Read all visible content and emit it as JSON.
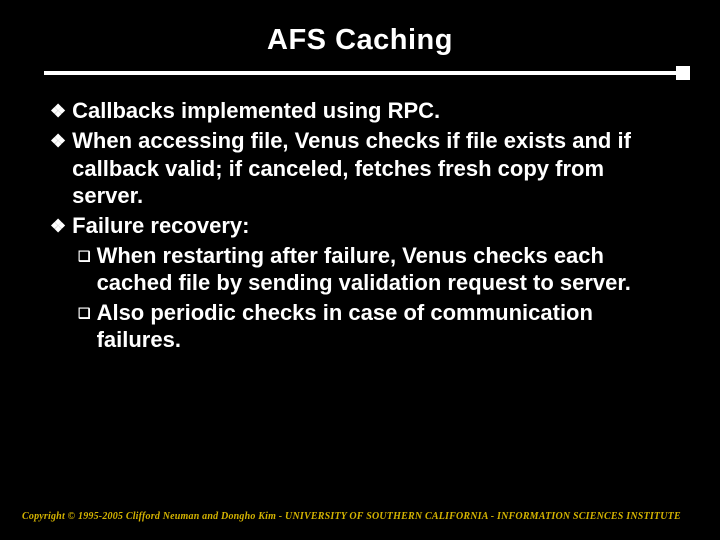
{
  "title": "AFS Caching",
  "bullets": [
    {
      "text": "Callbacks implemented using RPC."
    },
    {
      "text": "When accessing file, Venus checks if file exists and if callback valid; if canceled, fetches fresh copy from server."
    },
    {
      "text": "Failure recovery:",
      "sub": [
        {
          "text": "When restarting after failure, Venus checks each cached file by sending validation request to server."
        },
        {
          "text": "Also periodic checks in case of communication failures."
        }
      ]
    }
  ],
  "footer": "Copyright © 1995-2005 Clifford Neuman and Dongho Kim - UNIVERSITY OF SOUTHERN CALIFORNIA - INFORMATION SCIENCES INSTITUTE",
  "glyphs": {
    "diamond": "❖",
    "square": "❑"
  }
}
